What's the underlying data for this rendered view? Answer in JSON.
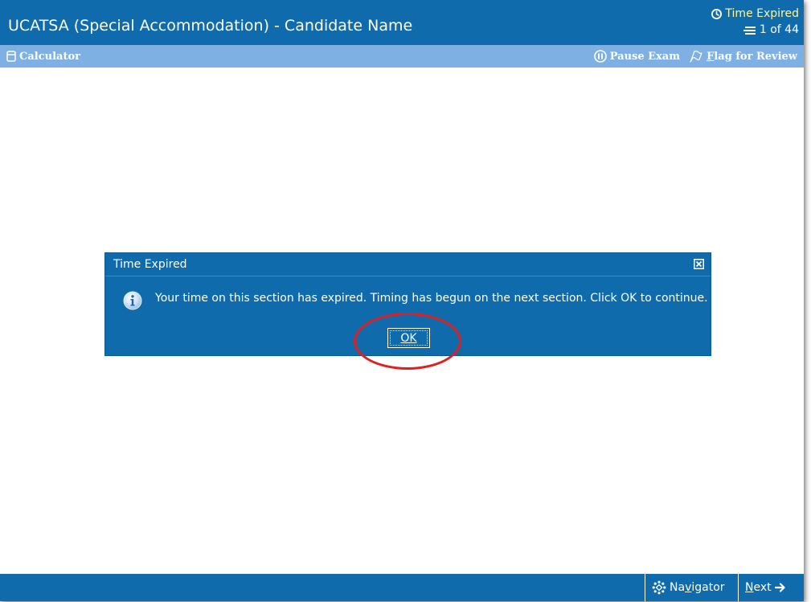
{
  "window": {
    "title": "UCATSA (Special Accommodation) - Candidate Name"
  },
  "status": {
    "timer_text": "Time Expired",
    "timer_color": "#fff799",
    "question_counter": "1 of 44"
  },
  "toolbar": {
    "calculator_label": "Calculator",
    "pause_label": "Pause Exam",
    "flag_label_hotkey": "F",
    "flag_label_rest": "lag for Review"
  },
  "dialog": {
    "title": "Time Expired",
    "message": "Your time on this section has expired. Timing has begun on the next section. Click OK to continue.",
    "ok_label": "OK",
    "icon": "info-icon",
    "close_icon": "close-icon"
  },
  "footer": {
    "navigator_label_pre": "Na",
    "navigator_label_hotkey": "v",
    "navigator_label_post": "igator",
    "next_label_hotkey": "N",
    "next_label_rest": "ext"
  },
  "colors": {
    "primary": "#0f6bac",
    "toolbar": "#7fb0e3",
    "highlight": "#e02020"
  }
}
